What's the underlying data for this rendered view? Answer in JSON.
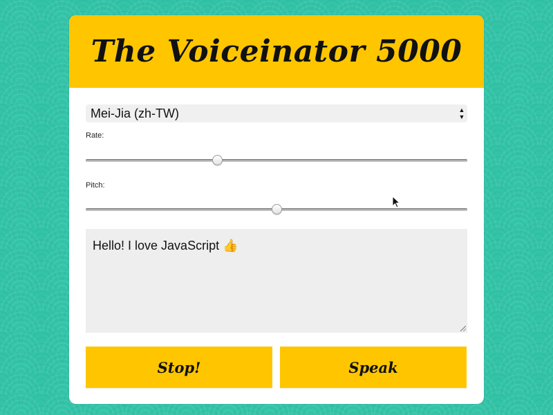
{
  "app": {
    "title": "The Voiceinator 5000"
  },
  "voice_select": {
    "selected": "Mei-Jia (zh-TW)"
  },
  "rate": {
    "label": "Rate:",
    "value_fraction": 0.345
  },
  "pitch": {
    "label": "Pitch:",
    "value_fraction": 0.5
  },
  "message": {
    "text": "Hello! I love JavaScript 👍"
  },
  "buttons": {
    "stop_label": "Stop!",
    "speak_label": "Speak"
  },
  "colors": {
    "background": "#33c4a8",
    "accent": "#ffc600"
  },
  "icons": {
    "select_arrows": "select-arrows-icon",
    "resize": "resize-grip-icon",
    "cursor": "mouse-cursor-icon"
  }
}
